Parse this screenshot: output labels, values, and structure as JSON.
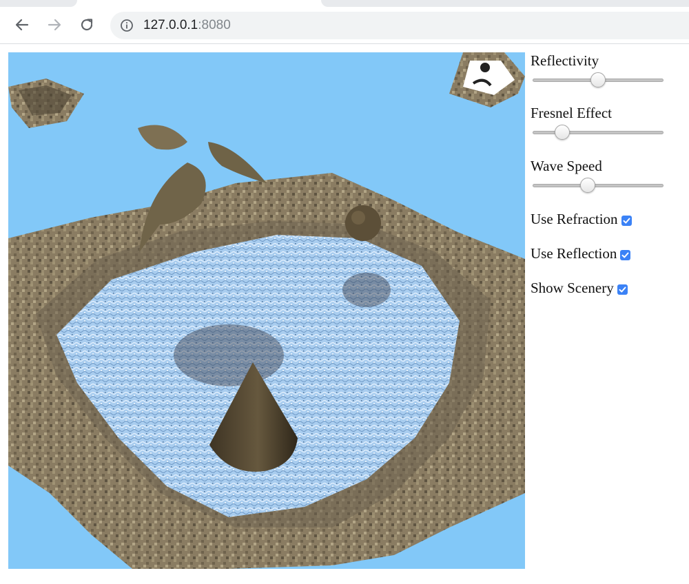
{
  "browser": {
    "url_host": "127.0.0.1",
    "url_port": ":8080",
    "icons": {
      "back": "arrow-left-icon",
      "forward": "arrow-right-icon",
      "reload": "reload-icon",
      "site_info": "info-icon"
    }
  },
  "scene": {
    "sky_color": "#82c8f8",
    "water_color": "#a9cdef",
    "rock_color": "#8a7c62"
  },
  "controls": {
    "sliders": [
      {
        "label": "Reflectivity",
        "value": 0.5
      },
      {
        "label": "Fresnel Effect",
        "value": 0.19
      },
      {
        "label": "Wave Speed",
        "value": 0.41
      }
    ],
    "checkboxes": [
      {
        "label": "Use Refraction",
        "checked": true
      },
      {
        "label": "Use Reflection",
        "checked": true
      },
      {
        "label": "Show Scenery",
        "checked": true
      }
    ],
    "accent_color": "#3b82f6"
  }
}
